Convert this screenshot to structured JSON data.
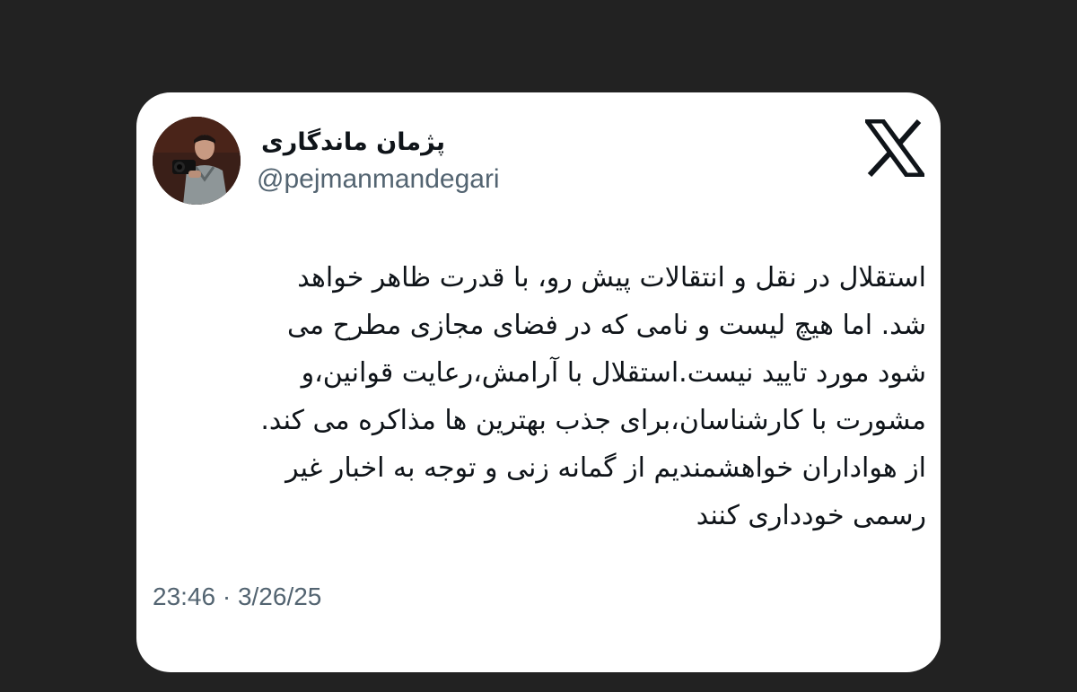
{
  "tweet": {
    "display_name": "پژمان ماندگاری",
    "username": "@pejmanmandegari",
    "brand_icon": "x-logo-icon",
    "avatar_icon": "profile-photo-photographer",
    "body_lines": [
      "استقلال در نقل و انتقالات پیش رو، با قدرت ظاهر خواهد",
      "شد. اما هیچ لیست و نامی که در فضای مجازی مطرح می",
      "شود مورد تایید نیست.استقلال با آرامش،رعایت قوانین،و",
      "مشورت با کارشناسان،برای جذب بهترین ها مذاکره می کند.",
      "از هواداران خواهشمندیم از گمانه زنی و توجه به اخبار غیر",
      "رسمی خودداری کنند"
    ],
    "timestamp": "23:46 · 3/26/25"
  },
  "colors": {
    "background": "#222222",
    "card": "#ffffff",
    "text_primary": "#0f1419",
    "text_secondary": "#536471"
  }
}
